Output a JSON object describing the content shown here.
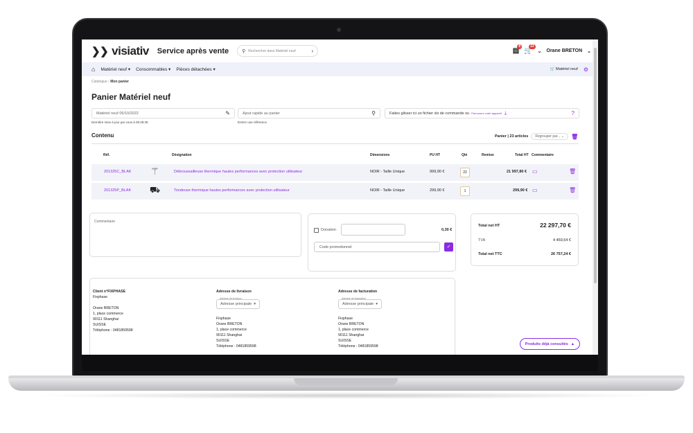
{
  "app": {
    "brand": "visiativ",
    "title": "Service après vente",
    "search_placeholder": "Rechercher dans Matériel neuf",
    "cart_badge_1": "8",
    "cart_badge_2": "23",
    "user": "Orane BRETON"
  },
  "nav": {
    "items": [
      "Matériel neuf ▾",
      "Consommables ▾",
      "Pièces détachées ▾"
    ],
    "right_label": "Matériel neuf"
  },
  "breadcrumb": {
    "root": "Catalogue",
    "current": "Mon panier"
  },
  "page": {
    "title": "Panier Matériel neuf"
  },
  "inputs": {
    "cart_name": "Matériel neuf 05/10/2022",
    "cart_hint": "Dernière mise à jour par vous à 09:48:39",
    "quick_add": "Ajout rapide au panier",
    "quick_hint": "Entrez une référence",
    "upload_text": "Faites glisser ici un fichier xls de commande ou",
    "upload_link": "Parcourez votre appareil"
  },
  "section": {
    "contenu": "Contenu",
    "panier": "Panier | 23 articles",
    "regroup": "Regrouper par..."
  },
  "table": {
    "headers": [
      "Réf.",
      "Désignation",
      "Dimensions",
      "PU HT",
      "Qté",
      "Remise",
      "Total HT",
      "Commentaire"
    ],
    "rows": [
      {
        "ref": "201325C_BLAK",
        "designation": "Débroussailleuse thermique hautes performances avec protection utilisateur",
        "dimensions": "NOIR - Taille Unique",
        "pu": "999,90 €",
        "qty": "22",
        "total": "21 997,80 €"
      },
      {
        "ref": "201325P_BLAK",
        "designation": "Tondeuse thermique hautes performances avec protection utilisateur",
        "dimensions": "NOIR - Taille Unique",
        "pu": "299,90 €",
        "qty": "1",
        "total": "299,90 €"
      }
    ]
  },
  "comment": {
    "label": "Commentaire"
  },
  "donation": {
    "label": "Donation",
    "amount": "0,30 €",
    "promo_placeholder": "Code promotionnel"
  },
  "totals": {
    "ht_label": "Total net HT",
    "ht": "22 297,70 €",
    "tva_label": "TVA",
    "tva": "4 459,54 €",
    "ttc_label": "Total net TTC",
    "ttc": "26 757,24 €"
  },
  "client": {
    "header": "Client n°FIXPHASE",
    "company": "Fixphase",
    "name": "Orane BRETON",
    "street": "1, place commerce",
    "city": "90111  Shanghai",
    "country": "SUISSE",
    "phone": "Téléphone : 0481859598"
  },
  "delivery": {
    "header": "Adresse de livraison",
    "select_label": "Adresse de livraison",
    "select": "Adresse principale",
    "company": "Fixphase",
    "name": "Orane BRETON",
    "street": "1, place commerce",
    "city": "90111  Shanghai",
    "country": "SUISSE",
    "phone": "Téléphone : 0481859598"
  },
  "billing": {
    "header": "Adresse de facturation",
    "select_label": "Adresse de facturation",
    "select": "Adresse principale",
    "company": "Fixphase",
    "name": "Orane BRETON",
    "street": "1, place commerce",
    "city": "90111  Shanghai",
    "country": "SUISSE",
    "phone": "Téléphone : 0481859598"
  },
  "viewed": {
    "label": "Produits déjà consultés"
  },
  "colors": {
    "accent": "#8a2be2",
    "nav_bg": "#eef0fa",
    "row_bg": "#f2f3f8"
  },
  "icons": [
    "search-icon",
    "cart-icon",
    "pencil-icon",
    "download-icon",
    "help-icon",
    "trash-icon",
    "comment-icon",
    "gear-icon",
    "home-icon",
    "check-icon"
  ]
}
